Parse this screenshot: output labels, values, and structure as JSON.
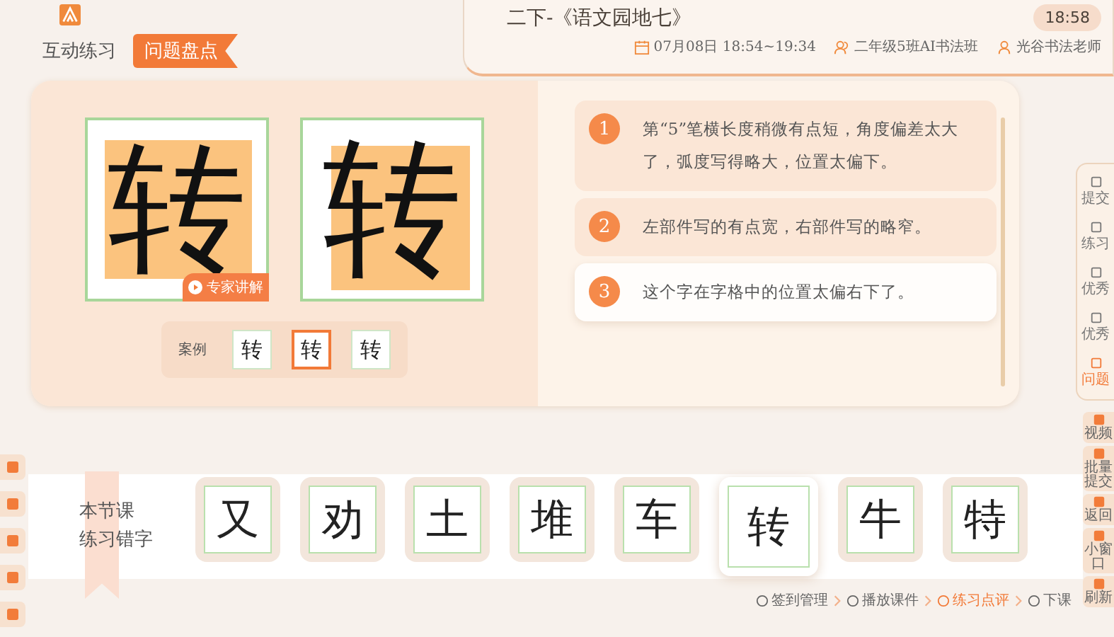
{
  "header": {
    "tabs": [
      {
        "label": "互动练习",
        "selected": false
      },
      {
        "label": "问题盘点",
        "selected": true
      }
    ]
  },
  "lesson": {
    "title": "二下-《语文园地七》",
    "time": "18:58",
    "date": "07月08日 18:54~19:34",
    "class_name": "二年级5班AI书法班",
    "teacher": "光谷书法老师"
  },
  "comparison": {
    "model_char": "转",
    "student_char": "转",
    "expert_button": "专家讲解",
    "samples_label": "案例",
    "samples": [
      {
        "char": "转",
        "selected": false
      },
      {
        "char": "转",
        "selected": true
      },
      {
        "char": "转",
        "selected": false
      }
    ]
  },
  "feedback": [
    {
      "number": "1",
      "text": "第“5”笔横长度稍微有点短，角度偏差太大了，弧度写得略大，位置太偏下。",
      "selected": false
    },
    {
      "number": "2",
      "text": "左部件写的有点宽，右部件写的略窄。",
      "selected": false
    },
    {
      "number": "3",
      "text": "这个字在字格中的位置太偏右下了。",
      "selected": true
    }
  ],
  "side_tools": [
    {
      "label": "提交",
      "selected": false
    },
    {
      "label": "练习",
      "selected": false
    },
    {
      "label": "优秀",
      "selected": false
    },
    {
      "label": "优秀",
      "selected": false
    },
    {
      "label": "问题",
      "selected": true
    }
  ],
  "corner_tools": [
    {
      "label": "视频"
    },
    {
      "label": "批量提交"
    },
    {
      "label": "返回"
    },
    {
      "label": "小窗口"
    },
    {
      "label": "刷新"
    }
  ],
  "error_chars": {
    "title": [
      "本节课",
      "练习错字"
    ],
    "chars": [
      {
        "char": "又",
        "selected": false
      },
      {
        "char": "劝",
        "selected": false
      },
      {
        "char": "土",
        "selected": false
      },
      {
        "char": "堆",
        "selected": false
      },
      {
        "char": "车",
        "selected": false
      },
      {
        "char": "转",
        "selected": true
      },
      {
        "char": "牛",
        "selected": false
      },
      {
        "char": "特",
        "selected": false
      }
    ]
  },
  "steps": [
    {
      "label": "签到管理",
      "selected": false
    },
    {
      "label": "播放课件",
      "selected": false
    },
    {
      "label": "练习点评",
      "selected": true
    },
    {
      "label": "下课",
      "selected": false
    }
  ]
}
